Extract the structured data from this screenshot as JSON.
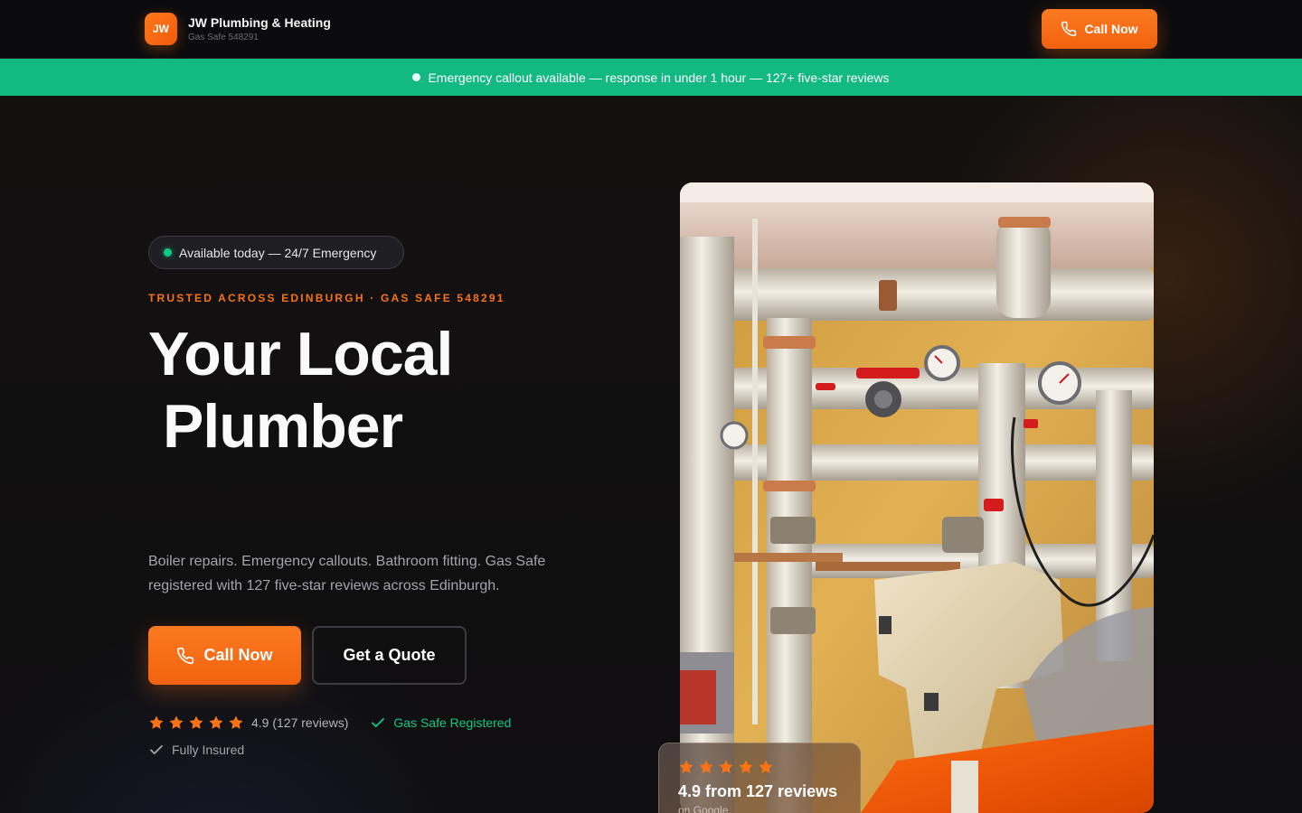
{
  "header": {
    "logo_initials": "JW",
    "brand_name": "JW Plumbing & Heating",
    "brand_sub": "Gas Safe 548291",
    "call_label": "Call Now"
  },
  "banner": {
    "text": "Emergency callout available — response in under 1 hour — 127+ five-star reviews"
  },
  "hero": {
    "pill": "Available today — 24/7 Emergency",
    "eyebrow": "TRUSTED ACROSS EDINBURGH · GAS SAFE 548291",
    "headline_line1": "Your Local",
    "headline_line2": "Plumber",
    "description": "Boiler repairs. Emergency callouts. Bathroom fitting. Gas Safe registered with 127 five-star reviews across Edinburgh.",
    "call_label": "Call Now",
    "quote_label": "Get a Quote",
    "rating_text": "4.9 (127 reviews)",
    "rating_stars": 5,
    "gas_safe": "Gas Safe Registered",
    "insured": "Fully Insured"
  },
  "review_card": {
    "stars": 5,
    "title": "4.9 from 127 reviews",
    "subtitle": "on Google"
  },
  "colors": {
    "accent": "#f97316",
    "success": "#10b981",
    "background": "#0d0d0f"
  },
  "icons": {
    "phone": "phone-icon",
    "star": "star-icon",
    "check": "check-icon"
  }
}
